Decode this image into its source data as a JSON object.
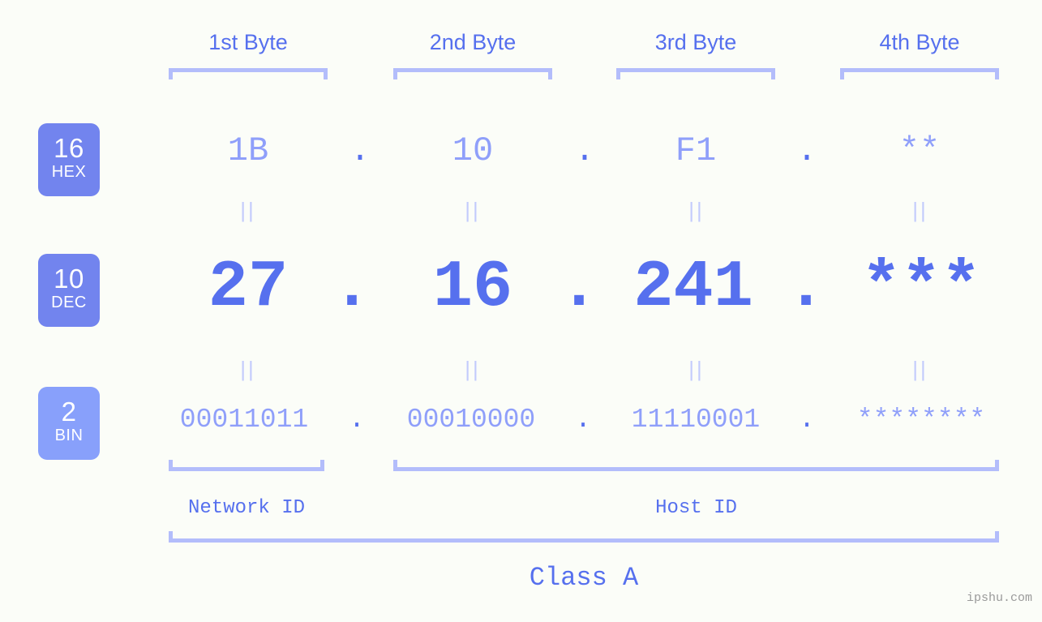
{
  "page": {
    "background_color": "#fbfdf8",
    "accent_strong": "#5670ee",
    "accent_mid": "#7284ee",
    "accent_light": "#8f9ffa",
    "accent_pale": "#b3bdfb",
    "watermark": "ipshu.com"
  },
  "byte_headers": [
    {
      "label": "1st Byte"
    },
    {
      "label": "2nd Byte"
    },
    {
      "label": "3rd Byte"
    },
    {
      "label": "4th Byte"
    }
  ],
  "radix_badges": [
    {
      "number": "16",
      "name": "HEX"
    },
    {
      "number": "10",
      "name": "DEC"
    },
    {
      "number": "2",
      "name": "BIN"
    }
  ],
  "rows": {
    "hex": {
      "values": [
        "1B",
        "10",
        "F1",
        "**"
      ],
      "separator": "."
    },
    "dec": {
      "values": [
        "27",
        "16",
        "241",
        "***"
      ],
      "separator": "."
    },
    "bin": {
      "values": [
        "00011011",
        "00010000",
        "11110001",
        "********"
      ],
      "separator": "."
    }
  },
  "equals_glyph": "||",
  "sections": [
    {
      "label": "Network ID"
    },
    {
      "label": "Host ID"
    }
  ],
  "class_label": "Class A"
}
